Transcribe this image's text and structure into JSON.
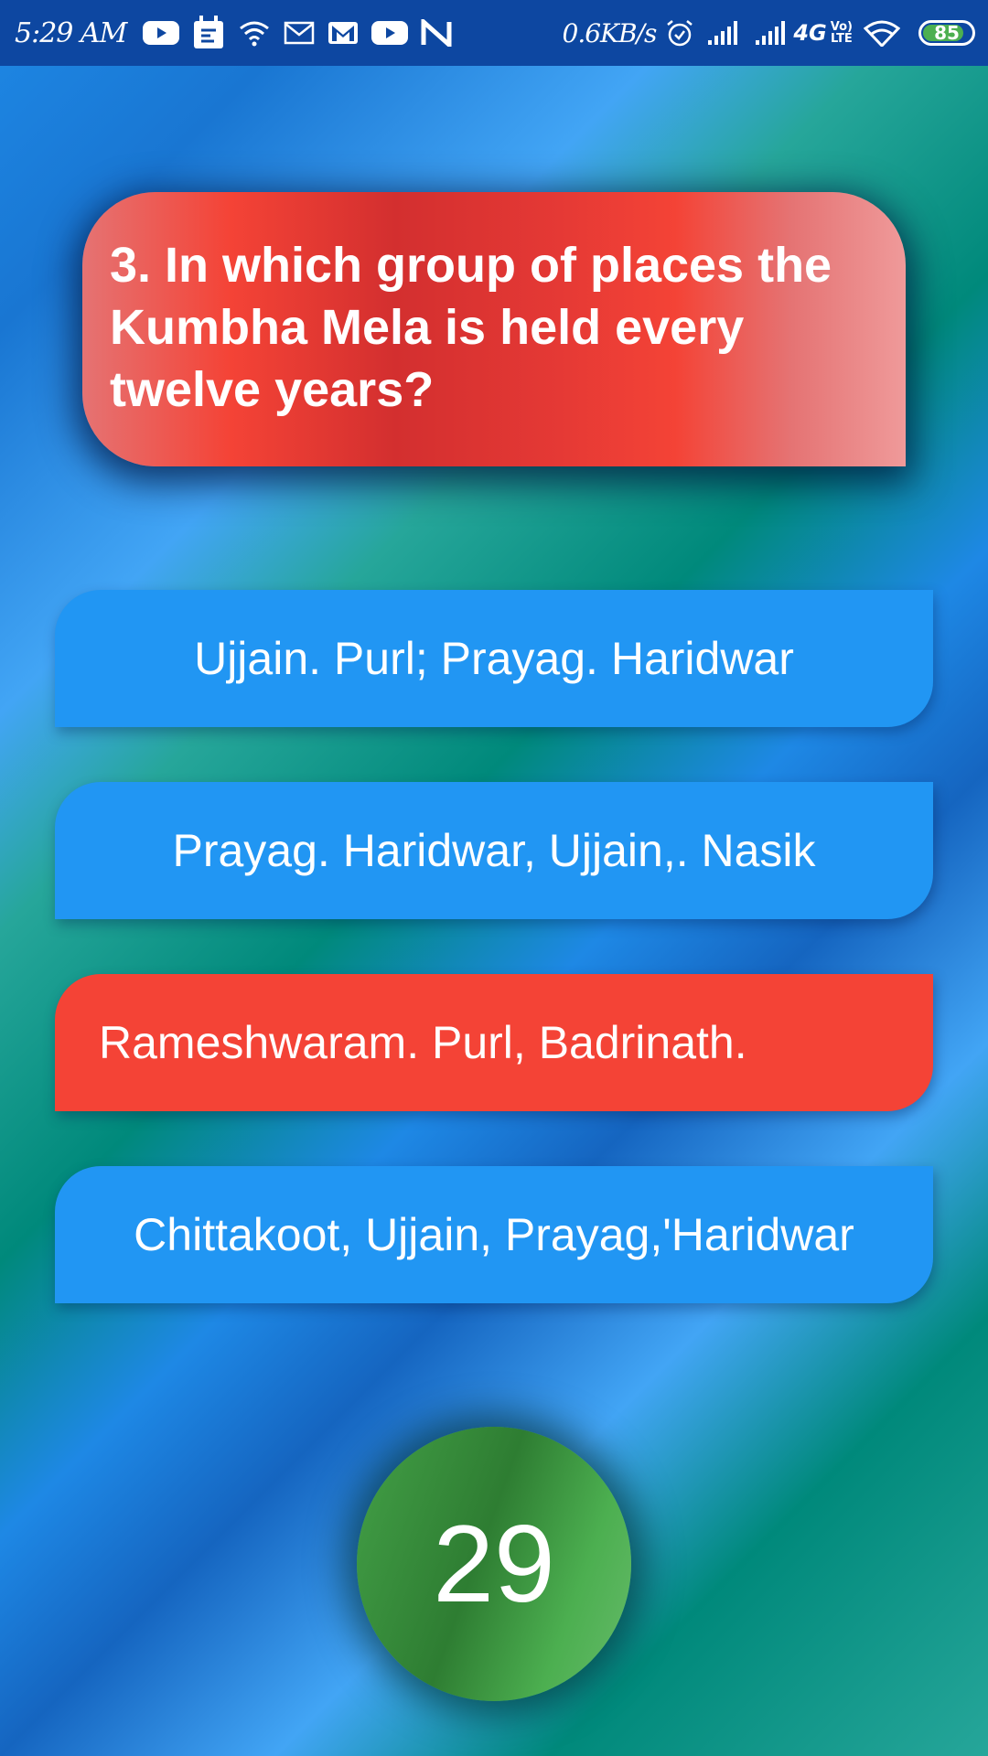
{
  "status_bar": {
    "time": "5:29 AM",
    "speed": "0.6KB/s",
    "network": "4G",
    "volte_top": "Vo)",
    "volte_bottom": "LTE",
    "battery": "85",
    "battery_level": 0.85,
    "icons": [
      "youtube-icon",
      "notification-app-icon",
      "wifi-icon",
      "mail-outline-icon",
      "gmail-icon",
      "youtube-icon",
      "n-app-icon",
      "alarm-icon",
      "signal-icon",
      "signal-icon",
      "wifi-icon",
      "battery-icon"
    ]
  },
  "question": {
    "text": "3. In which group of places the Kumbha Mela is held every twelve years?"
  },
  "options": [
    {
      "label": "Ujjain. Purl; Prayag. Haridwar",
      "state": "default"
    },
    {
      "label": "Prayag. Haridwar, Ujjain,. Nasik",
      "state": "default"
    },
    {
      "label": "Rameshwaram. Purl, Badrinath.",
      "state": "wrong"
    },
    {
      "label": "Chittakoot, Ujjain, Prayag,'Haridwar",
      "state": "default"
    }
  ],
  "timer": {
    "value": "29"
  },
  "colors": {
    "option_default": "#2196f3",
    "option_wrong": "#f44336",
    "question_card": "#f44336",
    "timer": "#43a047",
    "status_bar": "#0d47a1"
  }
}
